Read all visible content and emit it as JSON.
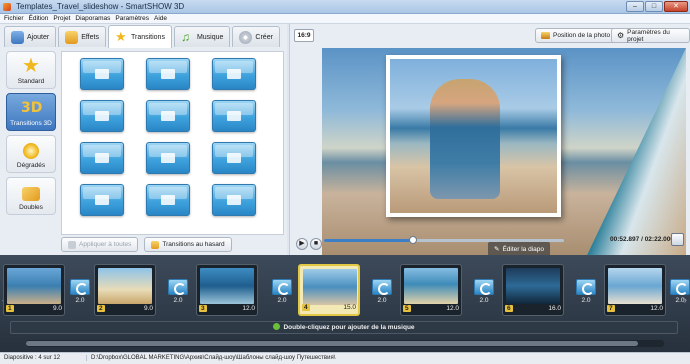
{
  "window": {
    "title": "Templates_Travel_slideshow - SmartSHOW 3D"
  },
  "menu": [
    "Fichier",
    "Édition",
    "Projet",
    "Diaporamas",
    "Paramètres",
    "Aide"
  ],
  "tabs": [
    {
      "label": "Ajouter",
      "icon": "photo-icon"
    },
    {
      "label": "Effets",
      "icon": "effects-icon"
    },
    {
      "label": "Transitions",
      "icon": "star-icon"
    },
    {
      "label": "Musique",
      "icon": "music-icon"
    },
    {
      "label": "Créer",
      "icon": "disc-icon"
    }
  ],
  "categories": [
    {
      "label": "Standard",
      "icon": "star-icon"
    },
    {
      "label": "Transitions 3D",
      "icon": "3d-icon"
    },
    {
      "label": "Dégradés",
      "icon": "gradient-icon"
    },
    {
      "label": "Doubles",
      "icon": "double-icon"
    }
  ],
  "left_buttons": {
    "apply_all": "Appliquer à toutes",
    "random": "Transitions au hasard"
  },
  "preview": {
    "ratio": "16:9",
    "photo_position": "Position de la photo",
    "project_settings": "Paramètres du projet",
    "edit_slide": "Éditer la diapo",
    "time": "00:52.897 / 02:22.000",
    "progress": 0.37
  },
  "timeline": {
    "slides": [
      {
        "num": "1",
        "duration": "9.0"
      },
      {
        "num": "2",
        "duration": "9.0"
      },
      {
        "num": "3",
        "duration": "12.0"
      },
      {
        "num": "4",
        "duration": "15.0"
      },
      {
        "num": "5",
        "duration": "12.0"
      },
      {
        "num": "6",
        "duration": "16.0"
      },
      {
        "num": "7",
        "duration": "12.0"
      }
    ],
    "transitions": [
      "2.0",
      "2.0",
      "2.0",
      "2.0",
      "2.0",
      "2.0",
      "2.0"
    ],
    "music_hint": "Double-cliquez pour ajouter de la musique"
  },
  "status": {
    "slide": "Diapositive : 4 sur 12",
    "path": "D:\\Dropbox\\GLOBAL MARKETING\\Архив\\Слайд-шоу\\Шаблоны слайд-шоу Путешествия\\"
  },
  "colors": {
    "accent": "#3d7fc7",
    "active_slide": "#e3c845",
    "timeline_bg": "#2f3a47"
  }
}
